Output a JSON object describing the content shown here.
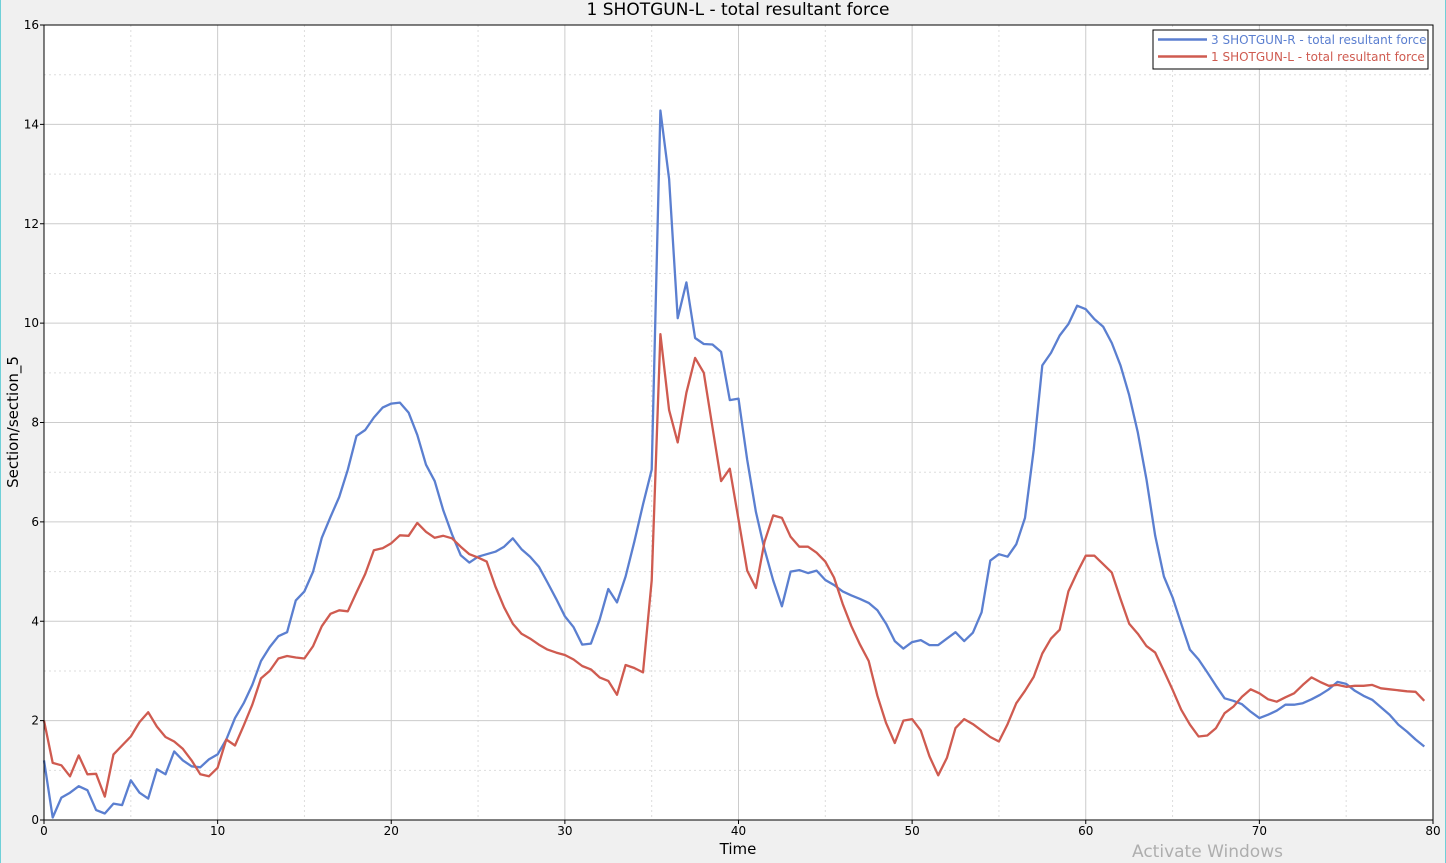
{
  "watermark": "Activate Windows",
  "chart_data": {
    "type": "line",
    "title": "1 SHOTGUN-L - total resultant force",
    "xlabel": "Time",
    "ylabel": "Section/section_5",
    "xlim": [
      0,
      80
    ],
    "ylim": [
      0,
      16
    ],
    "xticks": [
      0,
      10,
      20,
      30,
      40,
      50,
      60,
      70,
      80
    ],
    "yticks": [
      0,
      2,
      4,
      6,
      8,
      10,
      12,
      14,
      16
    ],
    "grid": true,
    "minor_grid": true,
    "legend_position": "top-right",
    "series": [
      {
        "name": "3 SHOTGUN-R - total resultant force",
        "color": "#5b7fd0",
        "points": [
          [
            0,
            1.2
          ],
          [
            0.5,
            0.05
          ],
          [
            1,
            0.45
          ],
          [
            1.5,
            0.55
          ],
          [
            2,
            0.68
          ],
          [
            2.5,
            0.6
          ],
          [
            3,
            0.2
          ],
          [
            3.5,
            0.13
          ],
          [
            4,
            0.33
          ],
          [
            4.5,
            0.3
          ],
          [
            5,
            0.8
          ],
          [
            5.5,
            0.55
          ],
          [
            6,
            0.43
          ],
          [
            6.5,
            1.02
          ],
          [
            7,
            0.92
          ],
          [
            7.5,
            1.38
          ],
          [
            8,
            1.2
          ],
          [
            8.5,
            1.08
          ],
          [
            9,
            1.06
          ],
          [
            9.5,
            1.22
          ],
          [
            10,
            1.32
          ],
          [
            10.5,
            1.62
          ],
          [
            11,
            2.05
          ],
          [
            11.5,
            2.35
          ],
          [
            12,
            2.72
          ],
          [
            12.5,
            3.2
          ],
          [
            13,
            3.48
          ],
          [
            13.5,
            3.7
          ],
          [
            14,
            3.78
          ],
          [
            14.5,
            4.42
          ],
          [
            15,
            4.6
          ],
          [
            15.5,
            5.0
          ],
          [
            16,
            5.68
          ],
          [
            16.5,
            6.1
          ],
          [
            17,
            6.5
          ],
          [
            17.5,
            7.05
          ],
          [
            18,
            7.73
          ],
          [
            18.5,
            7.85
          ],
          [
            19,
            8.1
          ],
          [
            19.5,
            8.3
          ],
          [
            20,
            8.38
          ],
          [
            20.5,
            8.4
          ],
          [
            21,
            8.2
          ],
          [
            21.5,
            7.75
          ],
          [
            22,
            7.15
          ],
          [
            22.5,
            6.82
          ],
          [
            23,
            6.23
          ],
          [
            23.5,
            5.75
          ],
          [
            24,
            5.33
          ],
          [
            24.5,
            5.18
          ],
          [
            25,
            5.3
          ],
          [
            25.5,
            5.35
          ],
          [
            26,
            5.4
          ],
          [
            26.5,
            5.5
          ],
          [
            27,
            5.67
          ],
          [
            27.5,
            5.45
          ],
          [
            28,
            5.3
          ],
          [
            28.5,
            5.1
          ],
          [
            29,
            4.78
          ],
          [
            29.5,
            4.45
          ],
          [
            30,
            4.1
          ],
          [
            30.5,
            3.88
          ],
          [
            31,
            3.53
          ],
          [
            31.5,
            3.55
          ],
          [
            32,
            4.03
          ],
          [
            32.5,
            4.65
          ],
          [
            33,
            4.38
          ],
          [
            33.5,
            4.9
          ],
          [
            34,
            5.6
          ],
          [
            34.5,
            6.35
          ],
          [
            35,
            7.05
          ],
          [
            35.5,
            14.28
          ],
          [
            36,
            12.9
          ],
          [
            36.5,
            10.1
          ],
          [
            37,
            10.82
          ],
          [
            37.5,
            9.7
          ],
          [
            38,
            9.58
          ],
          [
            38.5,
            9.57
          ],
          [
            39,
            9.42
          ],
          [
            39.5,
            8.45
          ],
          [
            40,
            8.48
          ],
          [
            40.5,
            7.25
          ],
          [
            41,
            6.2
          ],
          [
            41.5,
            5.45
          ],
          [
            42,
            4.82
          ],
          [
            42.5,
            4.3
          ],
          [
            43,
            5.0
          ],
          [
            43.5,
            5.03
          ],
          [
            44,
            4.97
          ],
          [
            44.5,
            5.02
          ],
          [
            45,
            4.83
          ],
          [
            45.5,
            4.73
          ],
          [
            46,
            4.6
          ],
          [
            46.5,
            4.52
          ],
          [
            47,
            4.45
          ],
          [
            47.5,
            4.37
          ],
          [
            48,
            4.22
          ],
          [
            48.5,
            3.95
          ],
          [
            49,
            3.6
          ],
          [
            49.5,
            3.45
          ],
          [
            50,
            3.58
          ],
          [
            50.5,
            3.62
          ],
          [
            51,
            3.52
          ],
          [
            51.5,
            3.52
          ],
          [
            52,
            3.65
          ],
          [
            52.5,
            3.78
          ],
          [
            53,
            3.6
          ],
          [
            53.5,
            3.77
          ],
          [
            54,
            4.18
          ],
          [
            54.5,
            5.22
          ],
          [
            55,
            5.35
          ],
          [
            55.5,
            5.3
          ],
          [
            56,
            5.55
          ],
          [
            56.5,
            6.08
          ],
          [
            57,
            7.45
          ],
          [
            57.5,
            9.15
          ],
          [
            58,
            9.4
          ],
          [
            58.5,
            9.75
          ],
          [
            59,
            9.98
          ],
          [
            59.5,
            10.35
          ],
          [
            60,
            10.28
          ],
          [
            60.5,
            10.08
          ],
          [
            61,
            9.93
          ],
          [
            61.5,
            9.6
          ],
          [
            62,
            9.15
          ],
          [
            62.5,
            8.55
          ],
          [
            63,
            7.8
          ],
          [
            63.5,
            6.85
          ],
          [
            64,
            5.72
          ],
          [
            64.5,
            4.9
          ],
          [
            65,
            4.48
          ],
          [
            65.5,
            3.95
          ],
          [
            66,
            3.43
          ],
          [
            66.5,
            3.23
          ],
          [
            67,
            2.97
          ],
          [
            67.5,
            2.7
          ],
          [
            68,
            2.45
          ],
          [
            68.5,
            2.4
          ],
          [
            69,
            2.33
          ],
          [
            69.5,
            2.18
          ],
          [
            70,
            2.05
          ],
          [
            70.5,
            2.12
          ],
          [
            71,
            2.2
          ],
          [
            71.5,
            2.32
          ],
          [
            72,
            2.32
          ],
          [
            72.5,
            2.35
          ],
          [
            73,
            2.43
          ],
          [
            73.5,
            2.52
          ],
          [
            74,
            2.63
          ],
          [
            74.5,
            2.78
          ],
          [
            75,
            2.74
          ],
          [
            75.5,
            2.6
          ],
          [
            76,
            2.5
          ],
          [
            76.5,
            2.42
          ],
          [
            77,
            2.27
          ],
          [
            77.5,
            2.12
          ],
          [
            78,
            1.92
          ],
          [
            78.5,
            1.78
          ],
          [
            79,
            1.62
          ],
          [
            79.5,
            1.48
          ]
        ]
      },
      {
        "name": "1 SHOTGUN-L - total resultant force",
        "color": "#cf5b50",
        "points": [
          [
            0,
            2.0
          ],
          [
            0.5,
            1.15
          ],
          [
            1,
            1.1
          ],
          [
            1.5,
            0.88
          ],
          [
            2,
            1.3
          ],
          [
            2.5,
            0.92
          ],
          [
            3,
            0.93
          ],
          [
            3.5,
            0.47
          ],
          [
            4,
            1.32
          ],
          [
            4.5,
            1.5
          ],
          [
            5,
            1.68
          ],
          [
            5.5,
            1.97
          ],
          [
            6,
            2.17
          ],
          [
            6.5,
            1.88
          ],
          [
            7,
            1.67
          ],
          [
            7.5,
            1.58
          ],
          [
            8,
            1.43
          ],
          [
            8.5,
            1.2
          ],
          [
            9,
            0.92
          ],
          [
            9.5,
            0.88
          ],
          [
            10,
            1.05
          ],
          [
            10.5,
            1.62
          ],
          [
            11,
            1.5
          ],
          [
            11.5,
            1.9
          ],
          [
            12,
            2.32
          ],
          [
            12.5,
            2.85
          ],
          [
            13,
            3.0
          ],
          [
            13.5,
            3.25
          ],
          [
            14,
            3.3
          ],
          [
            14.5,
            3.27
          ],
          [
            15,
            3.25
          ],
          [
            15.5,
            3.5
          ],
          [
            16,
            3.9
          ],
          [
            16.5,
            4.15
          ],
          [
            17,
            4.22
          ],
          [
            17.5,
            4.2
          ],
          [
            18,
            4.58
          ],
          [
            18.5,
            4.95
          ],
          [
            19,
            5.43
          ],
          [
            19.5,
            5.47
          ],
          [
            20,
            5.57
          ],
          [
            20.5,
            5.73
          ],
          [
            21,
            5.72
          ],
          [
            21.5,
            5.98
          ],
          [
            22,
            5.8
          ],
          [
            22.5,
            5.68
          ],
          [
            23,
            5.72
          ],
          [
            23.5,
            5.67
          ],
          [
            24,
            5.5
          ],
          [
            24.5,
            5.35
          ],
          [
            25,
            5.28
          ],
          [
            25.5,
            5.2
          ],
          [
            26,
            4.7
          ],
          [
            26.5,
            4.28
          ],
          [
            27,
            3.95
          ],
          [
            27.5,
            3.75
          ],
          [
            28,
            3.65
          ],
          [
            28.5,
            3.53
          ],
          [
            29,
            3.43
          ],
          [
            29.5,
            3.37
          ],
          [
            30,
            3.32
          ],
          [
            30.5,
            3.23
          ],
          [
            31,
            3.1
          ],
          [
            31.5,
            3.03
          ],
          [
            32,
            2.87
          ],
          [
            32.5,
            2.8
          ],
          [
            33,
            2.52
          ],
          [
            33.5,
            3.12
          ],
          [
            34,
            3.06
          ],
          [
            34.5,
            2.97
          ],
          [
            35,
            4.82
          ],
          [
            35.5,
            9.78
          ],
          [
            36,
            8.25
          ],
          [
            36.5,
            7.6
          ],
          [
            37,
            8.6
          ],
          [
            37.5,
            9.3
          ],
          [
            38,
            9.0
          ],
          [
            38.5,
            7.9
          ],
          [
            39,
            6.82
          ],
          [
            39.5,
            7.07
          ],
          [
            40,
            6.05
          ],
          [
            40.5,
            5.02
          ],
          [
            41,
            4.67
          ],
          [
            41.5,
            5.6
          ],
          [
            42,
            6.13
          ],
          [
            42.5,
            6.08
          ],
          [
            43,
            5.7
          ],
          [
            43.5,
            5.5
          ],
          [
            44,
            5.5
          ],
          [
            44.5,
            5.38
          ],
          [
            45,
            5.2
          ],
          [
            45.5,
            4.88
          ],
          [
            46,
            4.35
          ],
          [
            46.5,
            3.9
          ],
          [
            47,
            3.53
          ],
          [
            47.5,
            3.2
          ],
          [
            48,
            2.5
          ],
          [
            48.5,
            1.95
          ],
          [
            49,
            1.55
          ],
          [
            49.5,
            2.0
          ],
          [
            50,
            2.03
          ],
          [
            50.5,
            1.8
          ],
          [
            51,
            1.28
          ],
          [
            51.5,
            0.9
          ],
          [
            52,
            1.25
          ],
          [
            52.5,
            1.85
          ],
          [
            53,
            2.03
          ],
          [
            53.5,
            1.93
          ],
          [
            54,
            1.8
          ],
          [
            54.5,
            1.67
          ],
          [
            55,
            1.58
          ],
          [
            55.5,
            1.93
          ],
          [
            56,
            2.35
          ],
          [
            56.5,
            2.6
          ],
          [
            57,
            2.88
          ],
          [
            57.5,
            3.35
          ],
          [
            58,
            3.65
          ],
          [
            58.5,
            3.83
          ],
          [
            59,
            4.6
          ],
          [
            59.5,
            4.98
          ],
          [
            60,
            5.32
          ],
          [
            60.5,
            5.32
          ],
          [
            61,
            5.15
          ],
          [
            61.5,
            4.98
          ],
          [
            62,
            4.45
          ],
          [
            62.5,
            3.95
          ],
          [
            63,
            3.75
          ],
          [
            63.5,
            3.5
          ],
          [
            64,
            3.37
          ],
          [
            64.5,
            3.0
          ],
          [
            65,
            2.62
          ],
          [
            65.5,
            2.22
          ],
          [
            66,
            1.92
          ],
          [
            66.5,
            1.68
          ],
          [
            67,
            1.7
          ],
          [
            67.5,
            1.85
          ],
          [
            68,
            2.15
          ],
          [
            68.5,
            2.28
          ],
          [
            69,
            2.48
          ],
          [
            69.5,
            2.63
          ],
          [
            70,
            2.55
          ],
          [
            70.5,
            2.43
          ],
          [
            71,
            2.38
          ],
          [
            71.5,
            2.47
          ],
          [
            72,
            2.55
          ],
          [
            72.5,
            2.72
          ],
          [
            73,
            2.87
          ],
          [
            73.5,
            2.78
          ],
          [
            74,
            2.7
          ],
          [
            74.5,
            2.72
          ],
          [
            75,
            2.68
          ],
          [
            75.5,
            2.7
          ],
          [
            76,
            2.7
          ],
          [
            76.5,
            2.72
          ],
          [
            77,
            2.65
          ],
          [
            77.5,
            2.63
          ],
          [
            78,
            2.61
          ],
          [
            78.5,
            2.59
          ],
          [
            79,
            2.58
          ],
          [
            79.5,
            2.4
          ]
        ]
      }
    ]
  }
}
